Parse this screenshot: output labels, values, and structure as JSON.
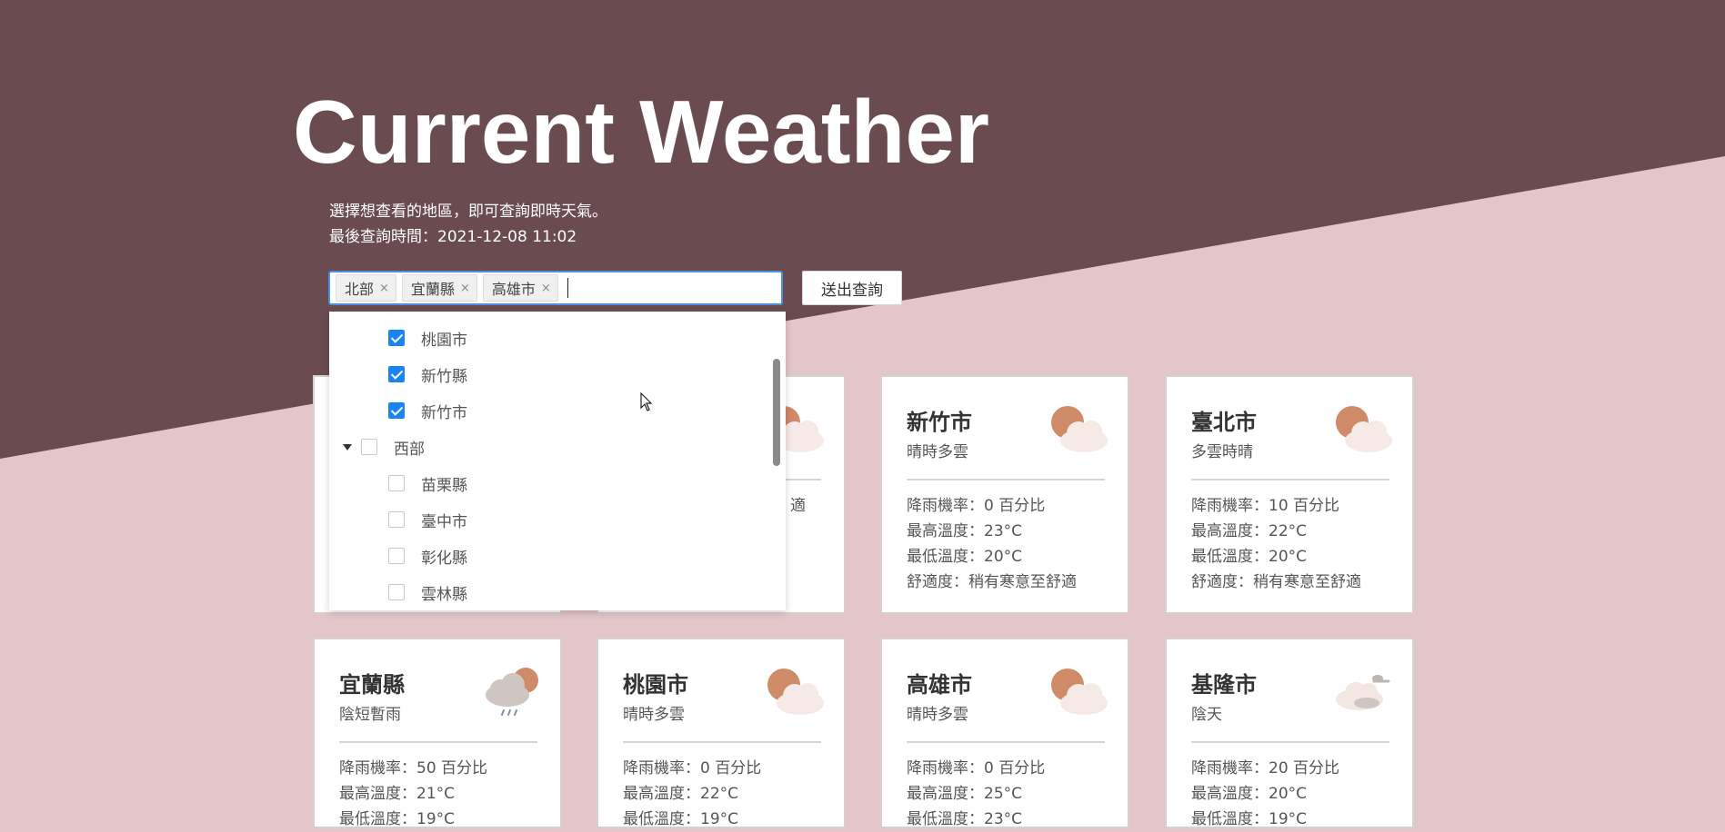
{
  "header": {
    "title": "Current Weather",
    "description": "選擇想查看的地區，即可查詢即時天氣。",
    "last_query": "最後查詢時間：2021-12-08 11:02"
  },
  "select": {
    "tags": [
      "北部",
      "宜蘭縣",
      "高雄市"
    ],
    "remove_icon": "×"
  },
  "submit_label": "送出查詢",
  "dropdown": {
    "items": [
      {
        "label": "桃園市",
        "checked": true,
        "level": 1
      },
      {
        "label": "新竹縣",
        "checked": true,
        "level": 1
      },
      {
        "label": "新竹市",
        "checked": true,
        "level": 1
      },
      {
        "label": "西部",
        "checked": false,
        "level": 0,
        "expanded": true
      },
      {
        "label": "苗栗縣",
        "checked": false,
        "level": 1
      },
      {
        "label": "臺中市",
        "checked": false,
        "level": 1
      },
      {
        "label": "彰化縣",
        "checked": false,
        "level": 1
      },
      {
        "label": "雲林縣",
        "checked": false,
        "level": 1
      }
    ]
  },
  "cards": [
    {
      "city": "",
      "condition": "",
      "icon": "partly-cloudy-icon",
      "lines": [
        "",
        "",
        "",
        ""
      ]
    },
    {
      "city": "",
      "condition": "",
      "icon": "partly-cloudy-icon",
      "lines": [
        "",
        "",
        "",
        "適"
      ]
    },
    {
      "city": "新竹市",
      "condition": "晴時多雲",
      "icon": "partly-cloudy-icon",
      "lines": [
        "降雨機率：0 百分比",
        "最高溫度：23°C",
        "最低溫度：20°C",
        "舒適度：稍有寒意至舒適"
      ]
    },
    {
      "city": "臺北市",
      "condition": "多雲時晴",
      "icon": "partly-cloudy-icon",
      "lines": [
        "降雨機率：10 百分比",
        "最高溫度：22°C",
        "最低溫度：20°C",
        "舒適度：稍有寒意至舒適"
      ]
    },
    {
      "city": "宜蘭縣",
      "condition": "陰短暫雨",
      "icon": "rain-cloud-icon",
      "lines": [
        "降雨機率：50 百分比",
        "最高溫度：21°C",
        "最低溫度：19°C"
      ]
    },
    {
      "city": "桃園市",
      "condition": "晴時多雲",
      "icon": "partly-cloudy-icon",
      "lines": [
        "降雨機率：0 百分比",
        "最高溫度：22°C",
        "最低溫度：19°C"
      ]
    },
    {
      "city": "高雄市",
      "condition": "晴時多雲",
      "icon": "partly-cloudy-icon",
      "lines": [
        "降雨機率：0 百分比",
        "最高溫度：25°C",
        "最低溫度：23°C"
      ]
    },
    {
      "city": "基隆市",
      "condition": "陰天",
      "icon": "overcast-icon",
      "lines": [
        "降雨機率：20 百分比",
        "最高溫度：20°C",
        "最低溫度：19°C"
      ]
    }
  ],
  "colors": {
    "header_bg": "#6a4c50",
    "page_bg": "#e3c6c9",
    "checkbox_accent": "#1a84f4",
    "sun": "#cf8a68"
  }
}
